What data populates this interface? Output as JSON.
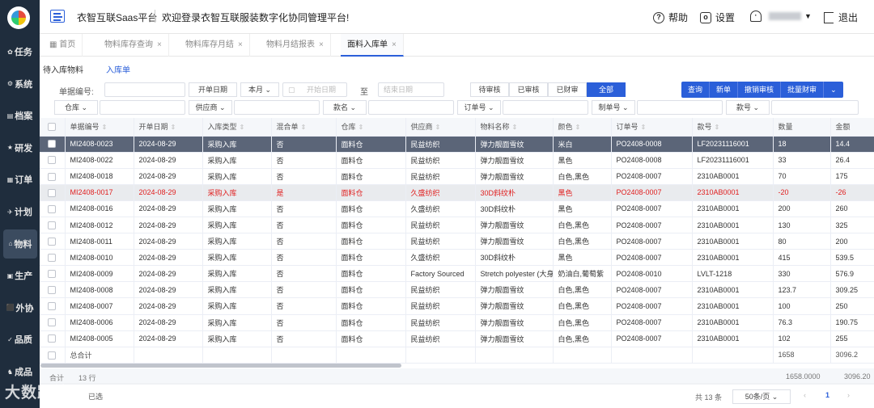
{
  "sidebar": {
    "items": [
      "任务",
      "系统",
      "档案",
      "研发",
      "订单",
      "计划",
      "物料",
      "生产",
      "外协",
      "品质",
      "成品"
    ],
    "active": "物料"
  },
  "header": {
    "title": "衣智互联Saas平台",
    "welcome": "欢迎登录衣智互联服装数字化协同管理平台!",
    "help": "帮助",
    "settings": "设置",
    "logout": "退出"
  },
  "tabs": [
    "首页",
    "物料库存查询",
    "物料库存月结",
    "物料月结报表",
    "面料入库单"
  ],
  "subtabs": [
    "待入库物料",
    "入库单"
  ],
  "filters": {
    "doc_no": "单据编号:",
    "open_date": "开单日期",
    "this_month": "本月",
    "start_date": "开始日期",
    "to": "至",
    "end_date": "结束日期",
    "warehouse": "仓库",
    "supplier": "供应商",
    "style": "款名",
    "order_no": "订单号",
    "contract_no": "制单号",
    "style_no": "款号",
    "status": [
      "待审核",
      "已审核",
      "已财审",
      "全部"
    ],
    "status_active": "全部",
    "actions": [
      "查询",
      "新单",
      "撤销审核",
      "批量财审",
      "⌄"
    ]
  },
  "table": {
    "headers": [
      "单据编号",
      "开单日期",
      "入库类型",
      "混合单",
      "仓库",
      "供应商",
      "物料名称",
      "颜色",
      "订单号",
      "款号",
      "数量",
      "金额"
    ],
    "rows": [
      [
        "MI2408-0023",
        "2024-08-29",
        "采购入库",
        "否",
        "面料仓",
        "民益纺织",
        "弹力靓面雪纹",
        "米白",
        "PO2408-0008",
        "LF20231116001",
        "18",
        "14.4"
      ],
      [
        "MI2408-0022",
        "2024-08-29",
        "采购入库",
        "否",
        "面料仓",
        "民益纺织",
        "弹力靓面雪纹",
        "黑色",
        "PO2408-0008",
        "LF20231116001",
        "33",
        "26.4"
      ],
      [
        "MI2408-0018",
        "2024-08-29",
        "采购入库",
        "否",
        "面料仓",
        "民益纺织",
        "弹力靓面雪纹",
        "白色,黑色",
        "PO2408-0007",
        "2310AB0001",
        "70",
        "175"
      ],
      [
        "MI2408-0017",
        "2024-08-29",
        "采购入库",
        "是",
        "面料仓",
        "久盛纺织",
        "30D斜纹朴",
        "黑色",
        "PO2408-0007",
        "2310AB0001",
        "-20",
        "-26"
      ],
      [
        "MI2408-0016",
        "2024-08-29",
        "采购入库",
        "否",
        "面料仓",
        "久盛纺织",
        "30D斜纹朴",
        "黑色",
        "PO2408-0007",
        "2310AB0001",
        "200",
        "260"
      ],
      [
        "MI2408-0012",
        "2024-08-29",
        "采购入库",
        "否",
        "面料仓",
        "民益纺织",
        "弹力靓面雪纹",
        "白色,黑色",
        "PO2408-0007",
        "2310AB0001",
        "130",
        "325"
      ],
      [
        "MI2408-0011",
        "2024-08-29",
        "采购入库",
        "否",
        "面料仓",
        "民益纺织",
        "弹力靓面雪纹",
        "白色,黑色",
        "PO2408-0007",
        "2310AB0001",
        "80",
        "200"
      ],
      [
        "MI2408-0010",
        "2024-08-29",
        "采购入库",
        "否",
        "面料仓",
        "久盛纺织",
        "30D斜纹朴",
        "黑色",
        "PO2408-0007",
        "2310AB0001",
        "415",
        "539.5"
      ],
      [
        "MI2408-0009",
        "2024-08-29",
        "采购入库",
        "否",
        "面料仓",
        "Factory Sourced",
        "Stretch polyester (大身",
        "奶油白,葡萄紫",
        "PO2408-0010",
        "LVLT-1218",
        "330",
        "576.9"
      ],
      [
        "MI2408-0008",
        "2024-08-29",
        "采购入库",
        "否",
        "面料仓",
        "民益纺织",
        "弹力靓面雪纹",
        "白色,黑色",
        "PO2408-0007",
        "2310AB0001",
        "123.7",
        "309.25"
      ],
      [
        "MI2408-0007",
        "2024-08-29",
        "采购入库",
        "否",
        "面料仓",
        "民益纺织",
        "弹力靓面雪纹",
        "白色,黑色",
        "PO2408-0007",
        "2310AB0001",
        "100",
        "250"
      ],
      [
        "MI2408-0006",
        "2024-08-29",
        "采购入库",
        "否",
        "面料仓",
        "民益纺织",
        "弹力靓面雪纹",
        "白色,黑色",
        "PO2408-0007",
        "2310AB0001",
        "76.3",
        "190.75"
      ],
      [
        "MI2408-0005",
        "2024-08-29",
        "采购入库",
        "否",
        "面料仓",
        "民益纺织",
        "弹力靓面雪纹",
        "白色,黑色",
        "PO2408-0007",
        "2310AB0001",
        "102",
        "255"
      ]
    ],
    "total_label": "总合计",
    "total_qty": "1658",
    "total_amt": "3096.2"
  },
  "footer": {
    "label": "合计",
    "rows": "13 行",
    "qty": "1658.0000",
    "amt": "3096.20"
  },
  "pager": {
    "total": "共 13 条",
    "size": "50条/页",
    "page": "1",
    "watermark": "大数跨境",
    "left_text": "已选"
  }
}
